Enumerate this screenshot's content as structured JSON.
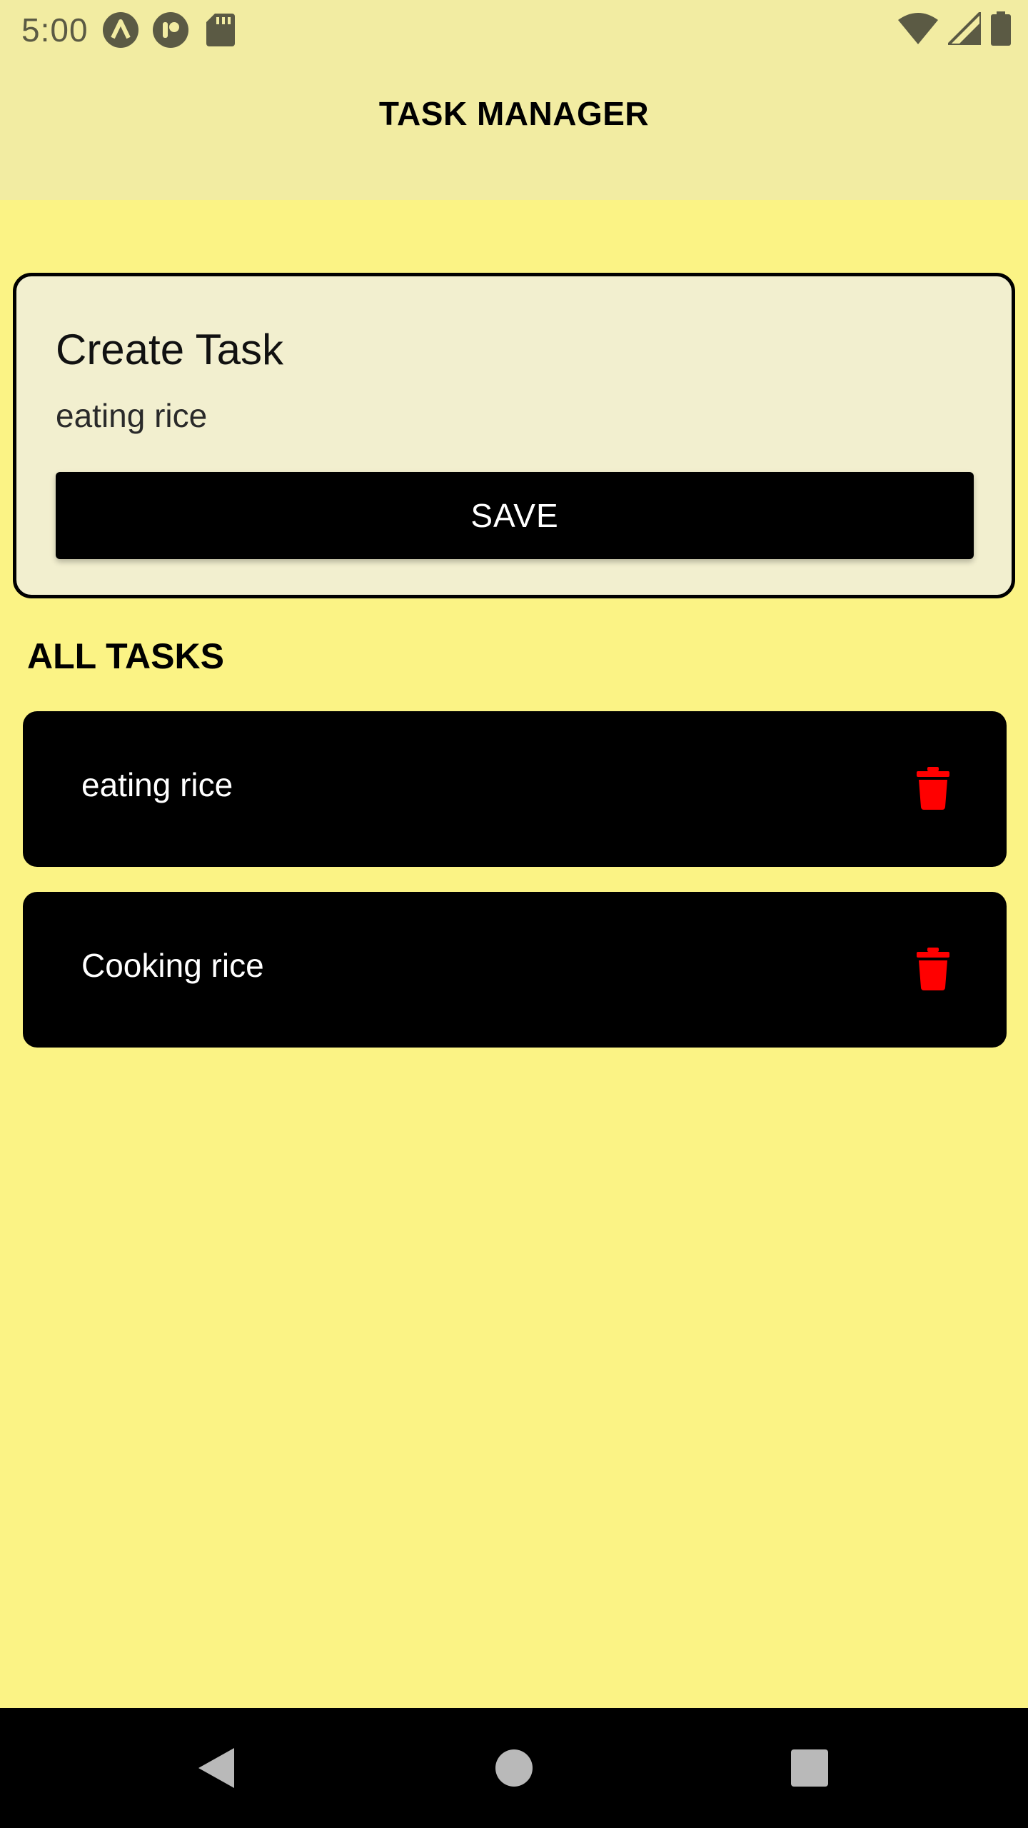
{
  "status_bar": {
    "time": "5:00",
    "icons": [
      "launcher-a-icon",
      "app-icon",
      "sd-card-icon",
      "wifi-icon",
      "signal-icon",
      "battery-icon"
    ]
  },
  "app_bar": {
    "title": "TASK MANAGER"
  },
  "create_task": {
    "title": "Create Task",
    "input_value": "eating rice",
    "save_label": "SAVE"
  },
  "all_tasks": {
    "title": "ALL TASKS",
    "items": [
      {
        "label": "eating rice"
      },
      {
        "label": "Cooking rice"
      }
    ]
  },
  "colors": {
    "background": "#fbf385",
    "app_bar": "#f2eca2",
    "card": "#f2efcf",
    "task_row": "#000000",
    "delete_icon": "#ff0000"
  }
}
